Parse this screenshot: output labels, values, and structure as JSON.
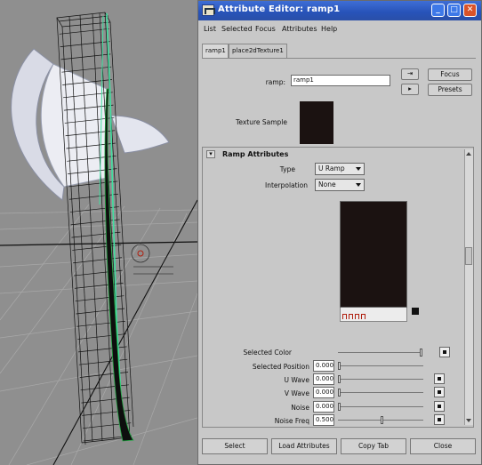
{
  "window": {
    "title": "Attribute Editor: ramp1",
    "buttons": [
      "minimize",
      "maximize",
      "close"
    ]
  },
  "menu": [
    "List",
    "Selected",
    "Focus",
    "Attributes",
    "Help"
  ],
  "tabs": [
    "ramp1",
    "place2dTexture1"
  ],
  "node": {
    "label": "ramp:",
    "value": "ramp1",
    "focus_label": "Focus",
    "presets_label": "Presets"
  },
  "texture_sample": {
    "label": "Texture Sample",
    "color": "#1b1211"
  },
  "ramp_attributes": {
    "header": "Ramp Attributes",
    "type_label": "Type",
    "type_value": "U Ramp",
    "interpolation_label": "Interpolation",
    "interpolation_value": "None",
    "ramp_color": "#1b1211",
    "selected_color_label": "Selected Color",
    "selected_position_label": "Selected Position",
    "selected_position_value": "0.000",
    "u_wave_label": "U Wave",
    "u_wave_value": "0.000",
    "v_wave_label": "V Wave",
    "v_wave_value": "0.000",
    "noise_label": "Noise",
    "noise_value": "0.000",
    "noise_freq_label": "Noise Freq",
    "noise_freq_value": "0.500"
  },
  "bottom_buttons": {
    "select": "Select",
    "load_attributes": "Load Attributes",
    "copy_tab": "Copy Tab",
    "close": "Close"
  },
  "colors": {
    "titlebar": "#2753b8",
    "wireframe_selected": "#40e0a0",
    "ramp_marker": "#b02010"
  }
}
